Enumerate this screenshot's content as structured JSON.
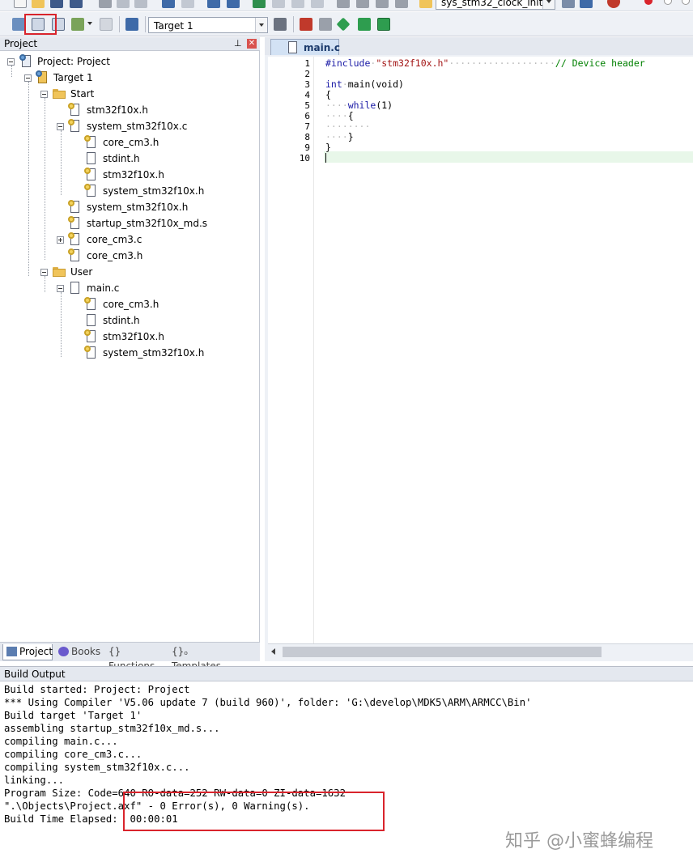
{
  "toolbar": {
    "function_combo": "sys_stm32_clock_init",
    "target_combo": "Target 1"
  },
  "project_panel": {
    "title": "Project",
    "tabs": [
      "Project",
      "Books",
      "{} Functions",
      "{}ₒ Templates"
    ]
  },
  "tree": {
    "root": "Project: Project",
    "target": "Target 1",
    "group_start": "Start",
    "start_files": {
      "f1": "stm32f10x.h",
      "f2": "system_stm32f10x.c",
      "f2_children": [
        "core_cm3.h",
        "stdint.h",
        "stm32f10x.h",
        "system_stm32f10x.h"
      ],
      "f3": "system_stm32f10x.h",
      "f4": "startup_stm32f10x_md.s",
      "f5": "core_cm3.c",
      "f6": "core_cm3.h"
    },
    "group_user": "User",
    "user_files": {
      "f1": "main.c",
      "f1_children": [
        "core_cm3.h",
        "stdint.h",
        "stm32f10x.h",
        "system_stm32f10x.h"
      ]
    }
  },
  "editor": {
    "tab_label": "main.c",
    "line_numbers": [
      "1",
      "2",
      "3",
      "4",
      "5",
      "6",
      "7",
      "8",
      "9",
      "10"
    ],
    "include_kw": "#include",
    "include_file": "\"stm32f10x.h\"",
    "include_comment": "// Device header",
    "line3_type": "int",
    "line3_rest": "main(void)",
    "line4": "{",
    "line5_kw": "while",
    "line5_rest": "(1)",
    "line6": "{",
    "line8": "}",
    "line9": "}"
  },
  "build_output": {
    "title": "Build Output",
    "lines": [
      "Build started: Project: Project",
      "*** Using Compiler 'V5.06 update 7 (build 960)', folder: 'G:\\develop\\MDK5\\ARM\\ARMCC\\Bin'",
      "Build target 'Target 1'",
      "assembling startup_stm32f10x_md.s...",
      "compiling main.c...",
      "compiling core_cm3.c...",
      "compiling system_stm32f10x.c...",
      "linking...",
      "Program Size: Code=640 RO-data=252 RW-data=0 ZI-data=1632",
      "\".\\Objects\\Project.axf\" - 0 Error(s), 0 Warning(s).",
      "Build Time Elapsed:  00:00:01"
    ]
  },
  "watermark": "知乎 @小蜜蜂编程"
}
